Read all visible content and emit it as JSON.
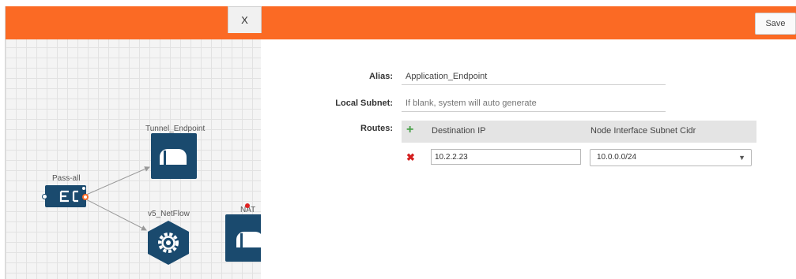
{
  "toolbar": {
    "close_label": "X",
    "save_label": "Save"
  },
  "canvas": {
    "nodes": {
      "tunnel": {
        "label": "Tunnel_Endpoint"
      },
      "pass_all": {
        "label": "Pass-all",
        "icon": "filter-e-icon"
      },
      "netflow": {
        "label": "v5_NetFlow",
        "icon": "gear-icon"
      },
      "nat": {
        "label": "NAT"
      }
    }
  },
  "form": {
    "alias": {
      "label": "Alias:",
      "value": "Application_Endpoint"
    },
    "local_subnet": {
      "label": "Local Subnet:",
      "placeholder": "If blank, system will auto generate"
    },
    "routes": {
      "label": "Routes:",
      "columns": [
        "Destination IP",
        "Node Interface Subnet Cidr"
      ],
      "rows": [
        {
          "destination_ip": "10.2.2.23",
          "subnet_cidr": "10.0.0.0/24"
        }
      ]
    }
  },
  "colors": {
    "accent": "#fb6a24",
    "node": "#1a4a6e",
    "add": "#46a046",
    "remove": "#d42020"
  }
}
